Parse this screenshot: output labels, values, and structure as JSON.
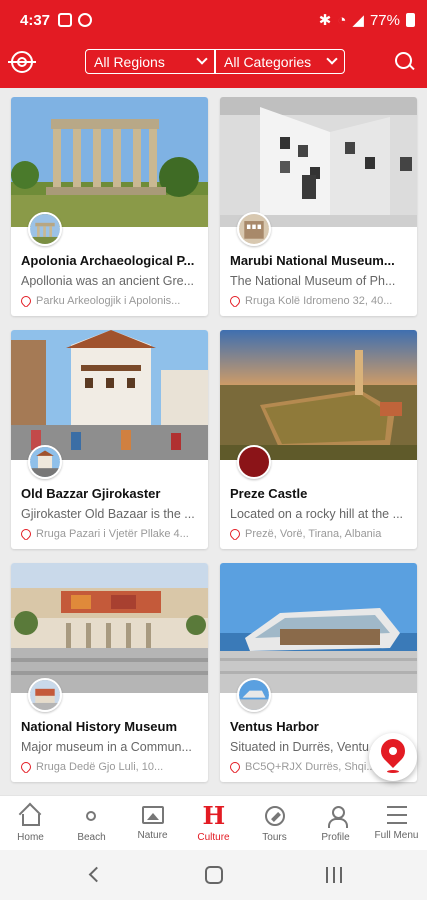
{
  "status": {
    "time": "4:37",
    "battery": "77%"
  },
  "filters": {
    "regions": "All Regions",
    "categories": "All Categories"
  },
  "cards": [
    {
      "title": "Apolonia Archaeological P...",
      "desc": "Apollonia was an ancient Gre...",
      "address": "Parku Arkeologjik i Apolonis..."
    },
    {
      "title": "Marubi National Museum...",
      "desc": "The National Museum of Ph...",
      "address": "Rruga Kolë Idromeno 32, 40..."
    },
    {
      "title": "Old Bazzar Gjirokaster",
      "desc": "Gjirokaster Old Bazaar is the ...",
      "address": "Rruga Pazari i Vjetër Pllake 4..."
    },
    {
      "title": "Preze Castle",
      "desc": "Located on a rocky hill at the ...",
      "address": "Prezë, Vorë, Tirana, Albania"
    },
    {
      "title": "National History Museum",
      "desc": "Major museum in a Commun...",
      "address": "Rruga Dedë Gjo Luli, 10..."
    },
    {
      "title": "Ventus Harbor",
      "desc": "Situated in Durrës, Ventu...",
      "address": "BC5Q+RJX Durrës, Shqi..."
    }
  ],
  "tabs": [
    {
      "label": "Home",
      "icon": "home-icon"
    },
    {
      "label": "Beach",
      "icon": "sun-icon"
    },
    {
      "label": "Nature",
      "icon": "image-icon"
    },
    {
      "label": "Culture",
      "icon": "culture-h-icon"
    },
    {
      "label": "Tours",
      "icon": "compass-icon"
    },
    {
      "label": "Profile",
      "icon": "profile-icon"
    },
    {
      "label": "Full Menu",
      "icon": "menu-icon"
    }
  ],
  "colors": {
    "brand": "#e31b23",
    "active_tab": "#e31b23"
  }
}
